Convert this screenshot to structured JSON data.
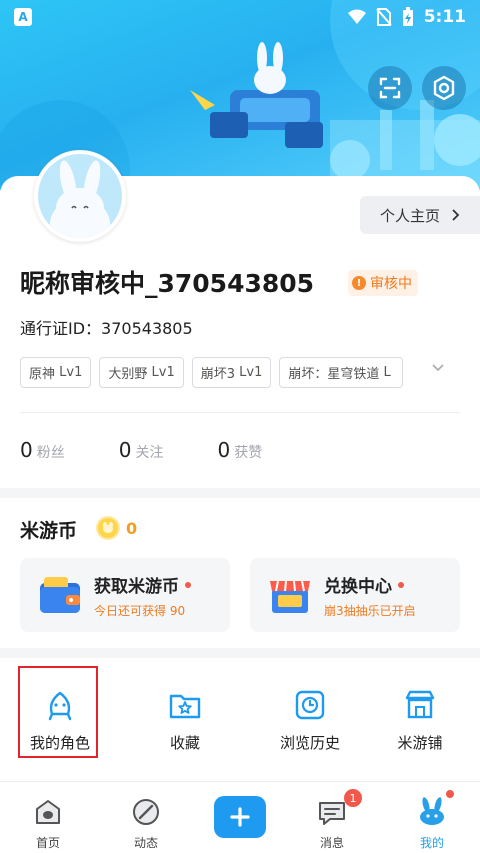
{
  "statusbar": {
    "time": "5:11",
    "app_badge": "A"
  },
  "profile": {
    "homepage_label": "个人主页",
    "nickname": "昵称审核中_370543805",
    "review_badge": "审核中",
    "passport": "通行证ID：370543805",
    "games": [
      {
        "name": "原神",
        "level": "Lv1"
      },
      {
        "name": "大别野",
        "level": "Lv1"
      },
      {
        "name": "崩坏3",
        "level": "Lv1"
      },
      {
        "name": "崩坏：星穹铁道",
        "level": "L"
      }
    ],
    "stats": [
      {
        "num": "0",
        "label": "粉丝"
      },
      {
        "num": "0",
        "label": "关注"
      },
      {
        "num": "0",
        "label": "获赞"
      }
    ]
  },
  "coins": {
    "title": "米游币",
    "count": "0",
    "cards": [
      {
        "title": "获取米游币",
        "sub": "今日还可获得 90"
      },
      {
        "title": "兑换中心",
        "sub": "崩3抽抽乐已开启"
      }
    ]
  },
  "functions": [
    {
      "label": "我的角色",
      "icon": "character-icon"
    },
    {
      "label": "收藏",
      "icon": "favorites-folder-icon"
    },
    {
      "label": "浏览历史",
      "icon": "history-clock-icon"
    },
    {
      "label": "米游铺",
      "icon": "shop-icon"
    }
  ],
  "nav": [
    {
      "label": "首页",
      "icon": "home-icon"
    },
    {
      "label": "动态",
      "icon": "feed-icon"
    },
    {
      "label": "消息",
      "icon": "message-icon",
      "badge": "1"
    },
    {
      "label": "我的",
      "icon": "profile-icon"
    }
  ],
  "colors": {
    "accent": "#1e9bf0",
    "badge_orange": "#f07b1f",
    "alert_red": "#f0584b",
    "highlight_box": "#e0262a"
  }
}
